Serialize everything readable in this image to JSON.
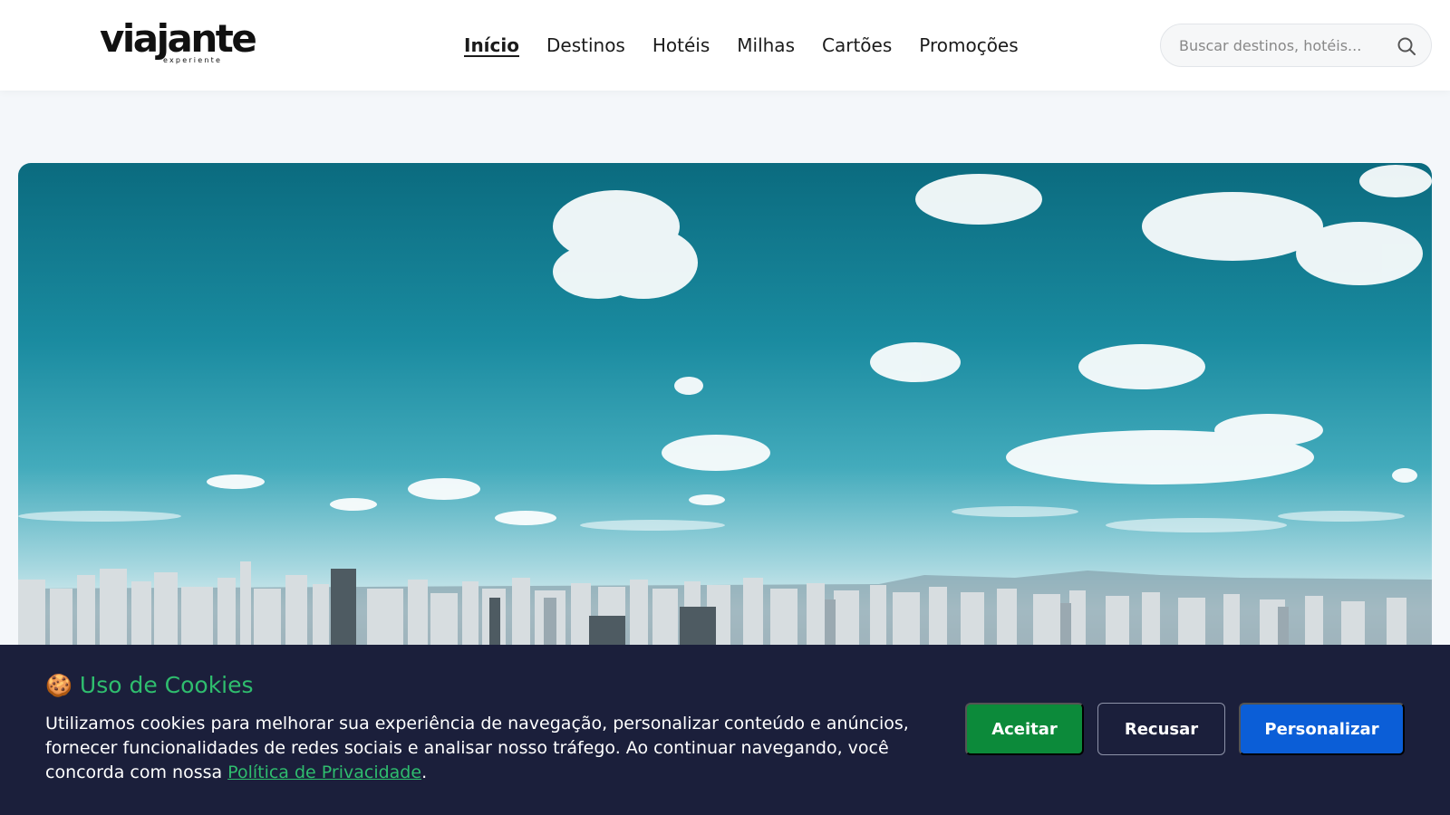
{
  "logo": {
    "main": "viajante",
    "sub": "experiente"
  },
  "nav": {
    "items": [
      {
        "label": "Início",
        "active": true
      },
      {
        "label": "Destinos",
        "active": false
      },
      {
        "label": "Hotéis",
        "active": false
      },
      {
        "label": "Milhas",
        "active": false
      },
      {
        "label": "Cartões",
        "active": false
      },
      {
        "label": "Promoções",
        "active": false
      }
    ]
  },
  "search": {
    "placeholder": "Buscar destinos, hotéis...",
    "icon": "search-icon"
  },
  "hero": {
    "image": "city-skyline-sky-clouds"
  },
  "cookie": {
    "emoji": "🍪",
    "title": "Uso de Cookies",
    "text": "Utilizamos cookies para melhorar sua experiência de navegação, personalizar conteúdo e anúncios, fornecer funcionalidades de redes sociais e analisar nosso tráfego. Ao continuar navegando, você concorda com nossa ",
    "link": "Política de Privacidade",
    "text_end": ".",
    "buttons": {
      "accept": "Aceitar",
      "decline": "Recusar",
      "customize": "Personalizar"
    }
  },
  "colors": {
    "accent_green": "#2fbd6e",
    "accept_green": "#0c8a3a",
    "customize_blue": "#0b5ed7",
    "banner_bg": "#1b1f3b"
  }
}
